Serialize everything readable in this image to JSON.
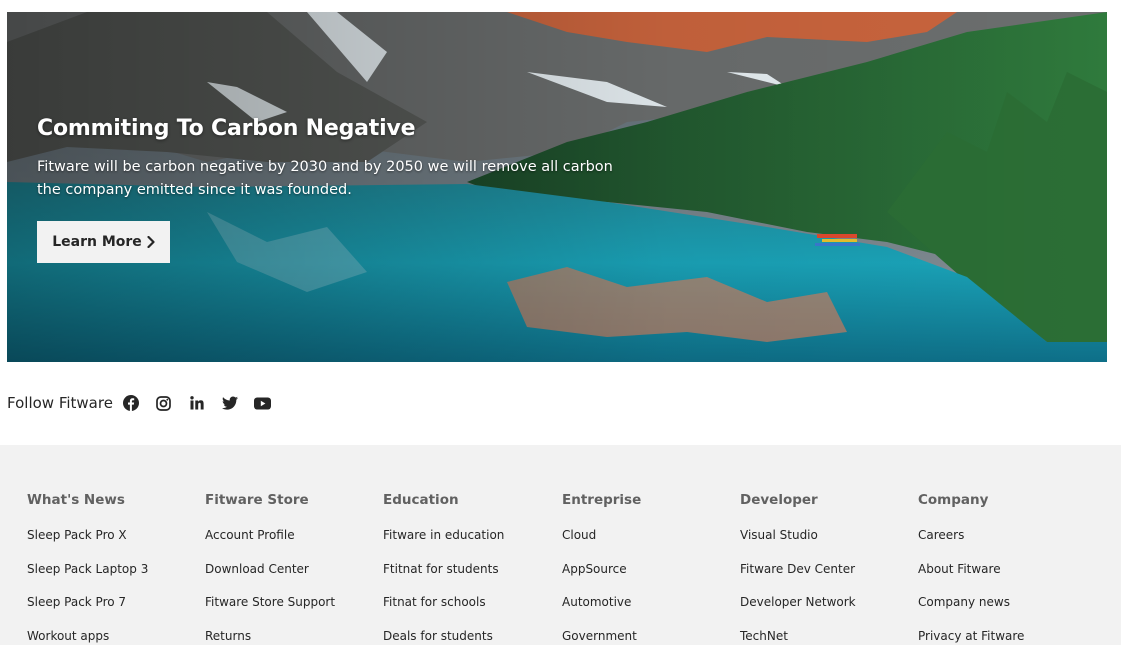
{
  "hero": {
    "title": "Commiting To Carbon Negative",
    "text": "Fitware will be carbon negative by 2030 and by 2050 we will remove all carbon the company emitted since it was founded.",
    "button_label": "Learn More"
  },
  "follow": {
    "label": "Follow Fitware",
    "icons": [
      "facebook-icon",
      "instagram-icon",
      "linkedin-icon",
      "twitter-icon",
      "youtube-icon"
    ]
  },
  "footer": {
    "columns": [
      {
        "title": "What's News",
        "links": [
          "Sleep Pack Pro X",
          "Sleep Pack Laptop 3",
          "Sleep Pack Pro 7",
          "Workout apps"
        ]
      },
      {
        "title": "Fitware Store",
        "links": [
          "Account Profile",
          "Download Center",
          "Fitware Store Support",
          "Returns"
        ]
      },
      {
        "title": "Education",
        "links": [
          "Fitware in education",
          "Ftitnat for students",
          "Fitnat for schools",
          "Deals for students"
        ]
      },
      {
        "title": "Entreprise",
        "links": [
          "Cloud",
          "AppSource",
          "Automotive",
          "Government"
        ]
      },
      {
        "title": "Developer",
        "links": [
          "Visual Studio",
          "Fitware Dev Center",
          "Developer Network",
          "TechNet"
        ]
      },
      {
        "title": "Company",
        "links": [
          "Careers",
          "About Fitware",
          "Company news",
          "Privacy at Fitware"
        ]
      }
    ]
  },
  "colors": {
    "footer_bg": "#f2f2f2",
    "footer_heading": "#616161",
    "text": "#262626",
    "button_bg": "#f2f2f2"
  }
}
